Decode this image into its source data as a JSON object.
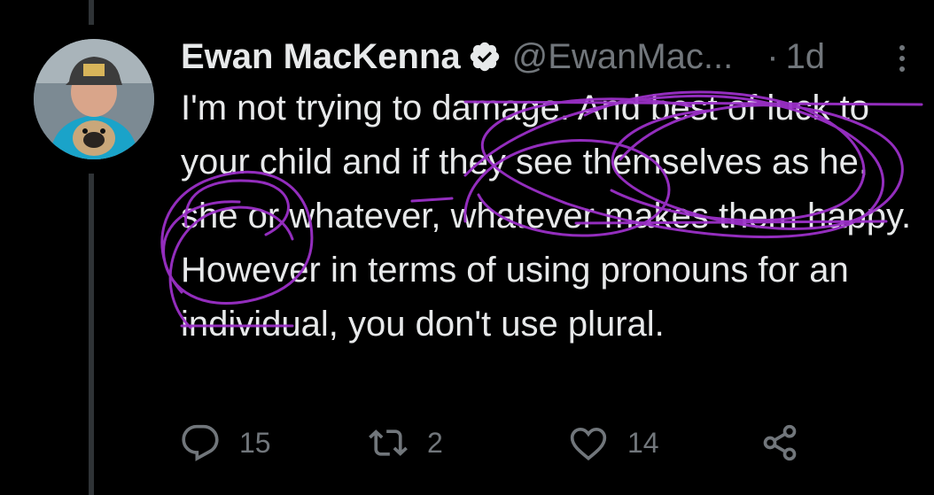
{
  "tweet": {
    "author_name": "Ewan MacKenna",
    "handle": "@EwanMac...",
    "separator": "·",
    "time": "1d",
    "text": "I'm not trying to damage. And best of luck to your child and if they see themselves as he, she or whatever, whatever makes them happy. However in terms of using pronouns for an individual, you don't use plural.",
    "reply_count": "15",
    "retweet_count": "2",
    "like_count": "14"
  },
  "colors": {
    "background": "#000000",
    "text": "#e7e9ea",
    "secondary": "#71767b",
    "verified_badge": "#e7e9ea",
    "annotation": "#9b30c8"
  },
  "icons": [
    "verified-badge-icon",
    "more-icon",
    "reply-icon",
    "retweet-icon",
    "like-icon",
    "share-icon"
  ]
}
